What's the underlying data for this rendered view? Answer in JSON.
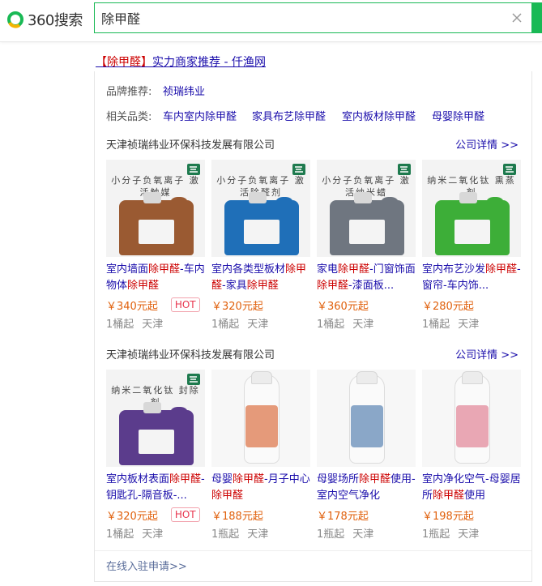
{
  "header": {
    "logo_text": "360搜索",
    "search_value": "除甲醛"
  },
  "ad": {
    "title_kw": "【除甲醛】",
    "title_rest": "实力商家推荐 - 仟渔网"
  },
  "brand_row": {
    "label": "品牌推荐:",
    "link": "祯瑞纬业"
  },
  "category_row": {
    "label": "相关品类:",
    "links": [
      "车内室内除甲醛",
      "家具布艺除甲醛",
      "室内板材除甲醛",
      "母婴除甲醛"
    ]
  },
  "sections": [
    {
      "company": "天津祯瑞纬业环保科技发展有限公司",
      "detail": "公司详情 >>",
      "products": [
        {
          "name_parts": [
            [
              "室内墙面",
              0
            ],
            [
              "除甲醛",
              1
            ],
            [
              "-车内物体",
              0
            ],
            [
              "除甲醛",
              1
            ]
          ],
          "img_text": "小分子负氧离子 激活触媒",
          "img_color": "#9a5a32",
          "img_type": "jug",
          "price": "￥340元起",
          "hot": "HOT",
          "min_qty": "1桶起",
          "location": "天津"
        },
        {
          "name_parts": [
            [
              "室内各类型板材",
              0
            ],
            [
              "除甲醛",
              1
            ],
            [
              "-家具",
              0
            ],
            [
              "除甲醛",
              1
            ]
          ],
          "img_text": "小分子负氧离子 激活除醛剂",
          "img_color": "#1f6fb8",
          "img_type": "jug",
          "price": "￥320元起",
          "hot": "",
          "min_qty": "1桶起",
          "location": "天津"
        },
        {
          "name_parts": [
            [
              "家电",
              0
            ],
            [
              "除甲醛",
              1
            ],
            [
              "-门窗饰面",
              0
            ],
            [
              "除甲醛",
              1
            ],
            [
              "-漆面板...",
              0
            ]
          ],
          "img_text": "小分子负氧离子 激活纳米蜡",
          "img_color": "#6f7680",
          "img_type": "jug",
          "price": "￥360元起",
          "hot": "",
          "min_qty": "1桶起",
          "location": "天津"
        },
        {
          "name_parts": [
            [
              "室内布艺沙发",
              0
            ],
            [
              "除甲醛",
              1
            ],
            [
              "-窗帘-车内饰...",
              0
            ]
          ],
          "img_text": "纳米二氧化钛 熏蒸剂",
          "img_color": "#3dae38",
          "img_type": "jug",
          "price": "￥280元起",
          "hot": "",
          "min_qty": "1桶起",
          "location": "天津"
        }
      ]
    },
    {
      "company": "天津祯瑞纬业环保科技发展有限公司",
      "detail": "公司详情 >>",
      "products": [
        {
          "name_parts": [
            [
              "室内板材表面",
              0
            ],
            [
              "除甲醛",
              1
            ],
            [
              "-钥匙孔-隔音板-...",
              0
            ]
          ],
          "img_text": "纳米二氧化钛 封除剂",
          "img_color": "#5b3c8c",
          "img_type": "jug",
          "price": "￥320元起",
          "hot": "HOT",
          "min_qty": "1桶起",
          "location": "天津"
        },
        {
          "name_parts": [
            [
              "母婴",
              0
            ],
            [
              "除甲醛",
              1
            ],
            [
              "-月子中心",
              0
            ],
            [
              "除甲醛",
              1
            ]
          ],
          "img_text": "",
          "img_color": "#e59a7a",
          "img_type": "bottle",
          "price": "￥188元起",
          "hot": "",
          "min_qty": "1瓶起",
          "location": "天津"
        },
        {
          "name_parts": [
            [
              "母婴场所",
              0
            ],
            [
              "除甲醛",
              1
            ],
            [
              "使用-室内空气净化",
              0
            ]
          ],
          "img_text": "",
          "img_color": "#8aa7c8",
          "img_type": "bottle",
          "price": "￥178元起",
          "hot": "",
          "min_qty": "1瓶起",
          "location": "天津"
        },
        {
          "name_parts": [
            [
              "室内净化空气-母婴居所",
              0
            ],
            [
              "除甲醛",
              1
            ],
            [
              "使用",
              0
            ]
          ],
          "img_text": "",
          "img_color": "#e9a7b4",
          "img_type": "bottle",
          "price": "￥198元起",
          "hot": "",
          "min_qty": "1瓶起",
          "location": "天津"
        }
      ]
    }
  ],
  "footer": {
    "apply_label": "在线入驻申请>>"
  }
}
